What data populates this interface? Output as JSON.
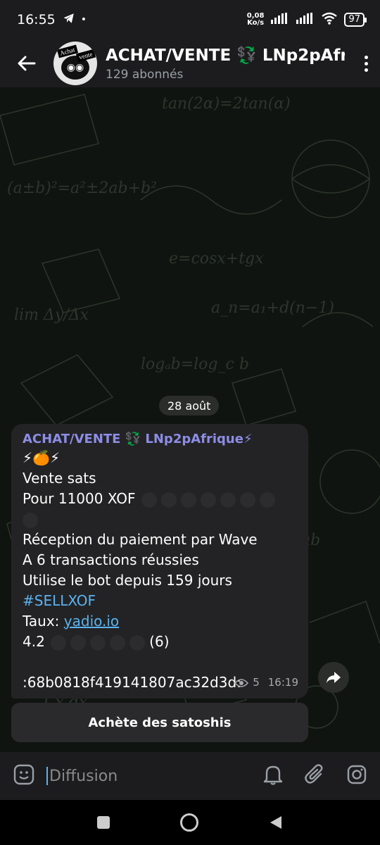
{
  "status_bar": {
    "time": "16:55",
    "network_speed_value": "0,08",
    "network_speed_unit": "Ko/s",
    "battery": "97"
  },
  "header": {
    "title": "ACHAT/VENTE 💱 LNp2pAfrique⚡",
    "subtitle": "129 abonnés",
    "avatar_text_1": "Achat",
    "avatar_text_2": "vente"
  },
  "chat": {
    "date": "28 août"
  },
  "message": {
    "author": "ACHAT/VENTE 💱 LNp2pAfrique⚡",
    "emoji_line": "⚡🍊⚡",
    "line1": "Vente sats",
    "line2": "Pour 11000 XOF",
    "line3": "Réception du paiement par Wave",
    "line4": "A 6 transactions réussies",
    "line5": "Utilise le bot depuis 159 jours",
    "hashtag": "#SELLXOF",
    "rate_label": "Taux:",
    "rate_link": "yadio.io",
    "rating": "4.2",
    "rating_count": "(6)",
    "code": ":68b0818f419141807ac32d3d:",
    "views": "5",
    "time": "16:19"
  },
  "action_button": {
    "label": "Achète des satoshis"
  },
  "composer": {
    "placeholder": "Diffusion"
  },
  "colors": {
    "accent": "#5ab3f0",
    "author": "#8d8de6",
    "bubble": "#232325"
  }
}
